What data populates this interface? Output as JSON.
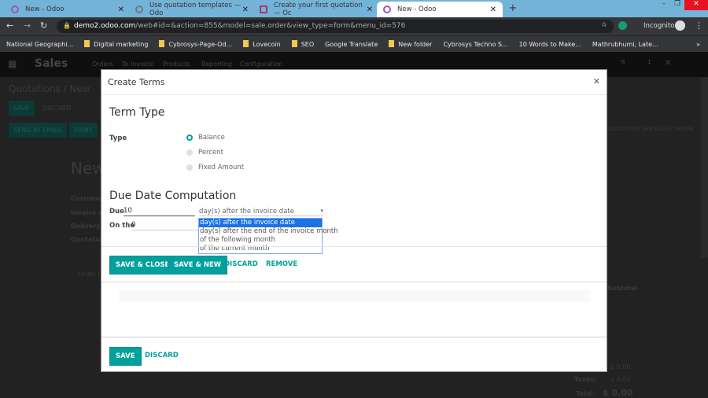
{
  "browser": {
    "tabs": [
      {
        "title": "New - Odoo"
      },
      {
        "title": "Use quotation templates — Odo"
      },
      {
        "title": "Create your first quotation — Oc"
      },
      {
        "title": "New - Odoo",
        "active": true
      }
    ],
    "url_host": "demo2.odoo.com",
    "url_path": "/web#id=&action=855&model=sale.order&view_type=form&menu_id=576",
    "profile": "Incognito",
    "bookmarks": [
      "National Geographi...",
      "Digital marketing",
      "Cybrosys-Page-Od...",
      "Lovecoin",
      "SEO",
      "Google Translate",
      "New folder",
      "Cybrosys Techno S...",
      "10 Words to Make...",
      "Mathrubhumi, Late..."
    ]
  },
  "app": {
    "name": "Sales",
    "menu": [
      "Orders",
      "To Invoice",
      "Products",
      "Reporting",
      "Configuration"
    ],
    "activity_count": "6",
    "message_count": "1",
    "breadcrumb": "Quotations / New",
    "save": "SAVE",
    "discard": "DISCARD",
    "send_email": "SEND BY EMAIL",
    "print": "PRINT",
    "status": [
      "QUOTATION SENT",
      "SALES ORDER"
    ],
    "title": "New",
    "fields": [
      "Customer",
      "Invoice Address",
      "Delivery Address",
      "Quotation Template"
    ],
    "order_lines": "Order Lines",
    "subtotal_col": "Subtotal",
    "untaxed": "$ 0.00",
    "taxes_label": "Taxes:",
    "taxes": "$ 0.00",
    "total_label": "Total:",
    "total": "$ 0.00"
  },
  "modal": {
    "title": "Create Terms",
    "term_type_heading": "Term Type",
    "type_label": "Type",
    "type_options": [
      {
        "label": "Balance",
        "selected": true
      },
      {
        "label": "Percent",
        "selected": false
      },
      {
        "label": "Fixed Amount",
        "selected": false
      }
    ],
    "due_heading": "Due Date Computation",
    "due_label": "Due",
    "due_value": "10",
    "on_the_label": "On the",
    "on_the_value": "0",
    "option_selected": "day(s) after the invoice date",
    "options": [
      "day(s) after the invoice date",
      "day(s) after the end of the invoice month",
      "of the following month",
      "of the current month"
    ],
    "save_close": "SAVE & CLOSE",
    "save_new": "SAVE & NEW",
    "discard": "DISCARD",
    "remove": "REMOVE",
    "outer_save": "SAVE",
    "outer_discard": "DISCARD"
  },
  "colors": {
    "accent": "#00a09d",
    "dropdown_highlight": "#1a73e8"
  }
}
